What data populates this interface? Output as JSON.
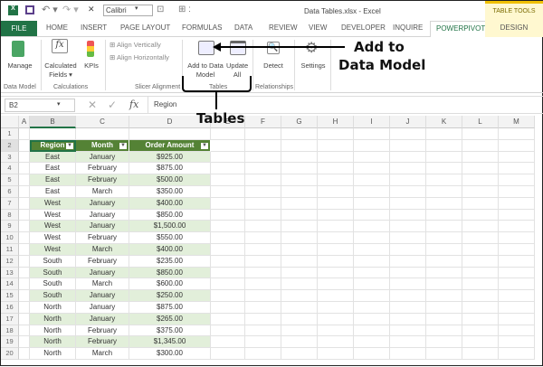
{
  "window": {
    "title": "Data Tables.xlsx - Excel",
    "font_name": "Calibri",
    "context_tab_group": "TABLE TOOLS"
  },
  "tabs": [
    "FILE",
    "HOME",
    "INSERT",
    "PAGE LAYOUT",
    "FORMULAS",
    "DATA",
    "REVIEW",
    "VIEW",
    "DEVELOPER",
    "INQUIRE",
    "POWERPIVOT",
    "DESIGN"
  ],
  "active_tab": "POWERPIVOT",
  "ribbon": {
    "manage": "Manage",
    "calculated_fields": "Calculated Fields ▾",
    "kpis": "KPIs",
    "align_vertically": "Align Vertically",
    "align_horizontally": "Align Horizontally",
    "add_to_data_model": "Add to Data Model",
    "update_all": "Update All",
    "detect": "Detect",
    "settings": "Settings",
    "groups": [
      "Data Model",
      "Calculations",
      "Slicer Alignment",
      "Tables",
      "Relationships"
    ]
  },
  "formula_bar": {
    "name_box": "B2",
    "fx": "fx",
    "value": "Region"
  },
  "annotations": {
    "add_to": "Add to",
    "data_model": "Data Model",
    "tables": "Tables"
  },
  "columns": [
    "A",
    "B",
    "C",
    "D",
    "E",
    "F",
    "G",
    "H",
    "I",
    "J",
    "K",
    "L",
    "M"
  ],
  "table": {
    "headers": [
      "Region",
      "Month",
      "Order Amount"
    ],
    "header_color": "#548235",
    "band_color": "#e2efda",
    "rows": [
      [
        "East",
        "January",
        "$925.00"
      ],
      [
        "East",
        "February",
        "$875.00"
      ],
      [
        "East",
        "February",
        "$500.00"
      ],
      [
        "East",
        "March",
        "$350.00"
      ],
      [
        "West",
        "January",
        "$400.00"
      ],
      [
        "West",
        "January",
        "$850.00"
      ],
      [
        "West",
        "January",
        "$1,500.00"
      ],
      [
        "West",
        "February",
        "$550.00"
      ],
      [
        "West",
        "March",
        "$400.00"
      ],
      [
        "South",
        "February",
        "$235.00"
      ],
      [
        "South",
        "January",
        "$850.00"
      ],
      [
        "South",
        "March",
        "$600.00"
      ],
      [
        "South",
        "January",
        "$250.00"
      ],
      [
        "North",
        "January",
        "$875.00"
      ],
      [
        "North",
        "January",
        "$265.00"
      ],
      [
        "North",
        "February",
        "$375.00"
      ],
      [
        "North",
        "February",
        "$1,345.00"
      ],
      [
        "North",
        "March",
        "$300.00"
      ]
    ]
  }
}
